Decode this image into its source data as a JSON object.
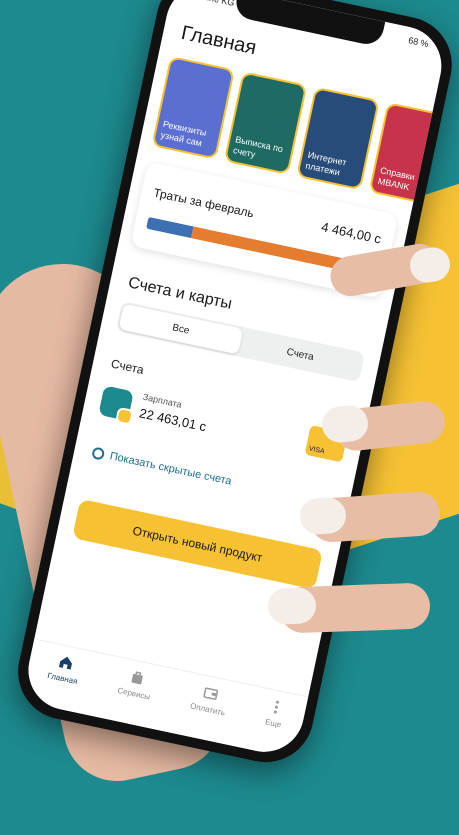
{
  "status": {
    "carrier": "Beeline KG",
    "battery": "68 %"
  },
  "page_title": "Главная",
  "stories": [
    {
      "label": "Реквизиты узнай сам",
      "color": "#5a6fd0"
    },
    {
      "label": "Выписка по счету",
      "color": "#1f6b64"
    },
    {
      "label": "Интернет платежи",
      "color": "#274c7a"
    },
    {
      "label": "Справки MBANK",
      "color": "#c7334a"
    }
  ],
  "spending": {
    "label": "Траты за февраль",
    "amount": "4 464,00 с",
    "segments": [
      {
        "color": "#3d6fb3",
        "fraction": 0.2
      },
      {
        "color": "#e47d2f",
        "fraction": 0.68
      },
      {
        "color": "#c98a3e",
        "fraction": 0.06
      },
      {
        "color": "#f1b93d",
        "fraction": 0.06
      }
    ]
  },
  "accounts_section": {
    "title": "Счета и карты",
    "tabs": [
      "Все",
      "Счета"
    ],
    "group_label": "Счета",
    "account": {
      "name": "Зарплата",
      "balance": "22 463,01 с",
      "card_text": "VISA"
    },
    "hidden_link": "Показать скрытые счета",
    "cta": "Открыть новый продукт"
  },
  "tabbar": [
    {
      "label": "Главная",
      "icon": "home-icon"
    },
    {
      "label": "Сервисы",
      "icon": "bag-icon"
    },
    {
      "label": "Оплатить",
      "icon": "wallet-icon"
    },
    {
      "label": "Еще",
      "icon": "more-icon"
    }
  ]
}
